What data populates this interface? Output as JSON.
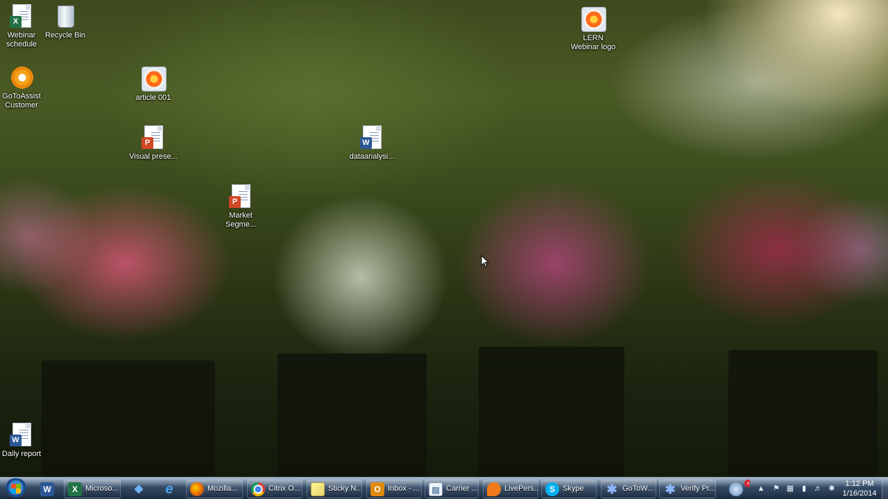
{
  "desktop": {
    "icons": [
      {
        "label": "Webinar\nschedule",
        "type": "excel"
      },
      {
        "label": "Recycle Bin",
        "type": "recycle"
      },
      {
        "label": "LERN\nWebinar logo",
        "type": "image"
      },
      {
        "label": "GoToAssist\nCustomer",
        "type": "gotoassist"
      },
      {
        "label": "article 001",
        "type": "image"
      },
      {
        "label": "Visual prese...",
        "type": "powerpoint"
      },
      {
        "label": "dataanalysi...",
        "type": "word"
      },
      {
        "label": "Market\nSegme...",
        "type": "powerpoint"
      },
      {
        "label": "Daily report",
        "type": "word"
      }
    ]
  },
  "taskbar": {
    "pinned": [
      {
        "name": "start-button"
      },
      {
        "icon": "word-icon",
        "glyph": "W",
        "color": "#2b5797"
      },
      {
        "icon": "dropbox-icon",
        "glyph": "◆",
        "color": "#2a7fd4"
      },
      {
        "icon": "internet-explorer-icon",
        "glyph": "e",
        "color": "#2a8de0"
      }
    ],
    "windows": [
      {
        "label": "Microso...",
        "icon": "excel-icon",
        "glyph": "X",
        "color": "#217346"
      },
      {
        "label": "Mozilla...",
        "icon": "firefox-icon",
        "glyph": "●",
        "color": "#e66000"
      },
      {
        "label": "Citrix O...",
        "icon": "chrome-icon",
        "glyph": "◉",
        "color": "#db4437"
      },
      {
        "label": "Sticky N...",
        "icon": "sticky-notes-icon",
        "glyph": "▤",
        "color": "#e8d36a"
      },
      {
        "label": "Inbox - ...",
        "icon": "outlook-icon",
        "glyph": "O",
        "color": "#e08a10"
      },
      {
        "label": "Carrier ...",
        "icon": "document-icon",
        "glyph": "▤",
        "color": "#5b7fa8"
      },
      {
        "label": "LivePers...",
        "icon": "liveperson-icon",
        "glyph": "◗",
        "color": "#f07a1a"
      },
      {
        "label": "Skype",
        "icon": "skype-icon",
        "glyph": "S",
        "color": "#00aff0"
      },
      {
        "label": "GoToW...",
        "icon": "gotowebinar-icon",
        "glyph": "✱",
        "color": "#3a6fd0"
      },
      {
        "label": "Verify Pr...",
        "icon": "gotowebinar-icon",
        "glyph": "✱",
        "color": "#3a6fd0"
      }
    ],
    "clock": {
      "time": "1:12 PM",
      "date": "1/16/2014"
    }
  }
}
